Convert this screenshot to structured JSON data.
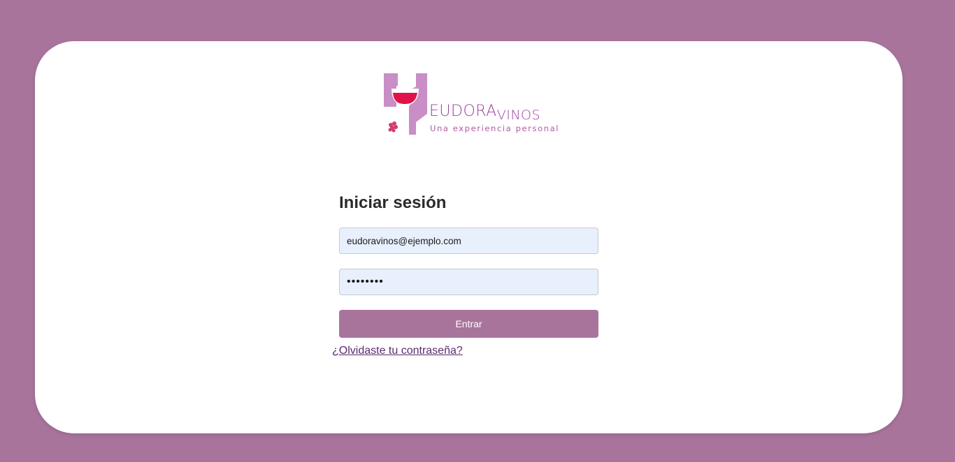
{
  "brand": {
    "name_part1": "EUDORA",
    "name_part2": "VINOS",
    "tagline": "Una experiencia personal"
  },
  "login": {
    "title": "Iniciar sesión",
    "email_value": "eudoravinos@ejemplo.com",
    "password_value": "••••••••",
    "submit_label": "Entrar",
    "forgot_link": "¿Olvidaste tu contraseña?"
  },
  "colors": {
    "background": "#a8749c",
    "card": "#ffffff",
    "button": "#a8749c",
    "input_fill": "#e8f0fe",
    "logo_purple": "#c98ec6",
    "logo_wine": "#e0124a",
    "link": "#5b2a6e"
  },
  "icons": {
    "logo_mark": "wine-glass-logo",
    "grapes": "grapes-icon"
  }
}
